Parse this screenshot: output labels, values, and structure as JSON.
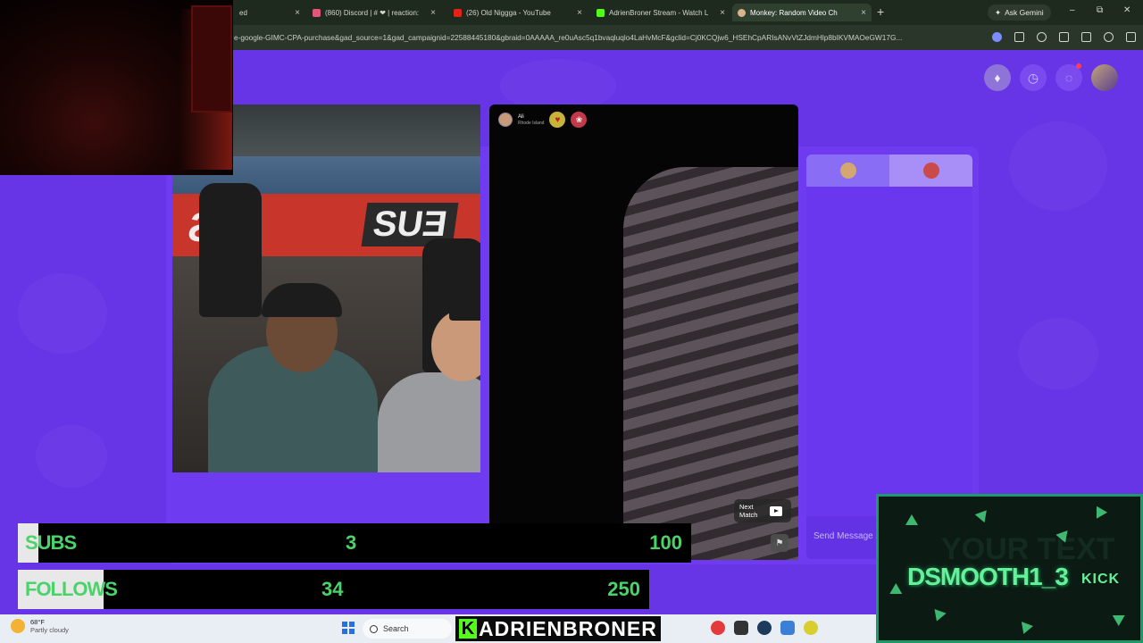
{
  "browser": {
    "tabs": [
      {
        "label": "ed",
        "favicon_color": "#000000"
      },
      {
        "label": "(860) Discord | # ❤ | reaction:",
        "favicon_color": "#e2567a"
      },
      {
        "label": "(26) Old Niggga - YouTube",
        "favicon_color": "#e62117"
      },
      {
        "label": "AdrienBroner Stream - Watch L",
        "favicon_color": "#53fc18"
      },
      {
        "label": "Monkey: Random Video Ch",
        "favicon_color": "#d9b38c"
      }
    ],
    "new_tab": "+",
    "gemini_label": "Ask Gemini",
    "url": "e-google-GIMC-CPA-purchase&gad_source=1&gad_campaignid=22588445180&gbraid=0AAAAA_re0uAsc5q1bvaqluqlo4LaHvMcF&gclid=Cj0KCQjw6_HSEhCpARIsANvVtZJdmHlp8bIKVMAOeGW17G...",
    "win_minimize": "–",
    "win_restore": "⧉",
    "win_close": "✕"
  },
  "page": {
    "accent": "#6734e6",
    "remote_user": {
      "name": "Ali",
      "location": "Rhode Island"
    },
    "next_match": "Next Match",
    "chat_placeholder": "Send Message"
  },
  "overlay": {
    "subs": {
      "label": "SUBS",
      "current": "3",
      "goal": "100",
      "progress": 0.03
    },
    "follows": {
      "label": "FOLLOWS",
      "current": "34",
      "goal": "250",
      "progress": 0.136
    },
    "kick_card": {
      "name": "DSMOOTH1_3",
      "platform": "KICK",
      "bg_text": "YOUR TEXT"
    },
    "kick_banner": {
      "letter": "K",
      "name": "ADRIENBRONER"
    }
  },
  "taskbar": {
    "temp": "68°F",
    "weather": "Partly cloudy",
    "search": "Search"
  }
}
